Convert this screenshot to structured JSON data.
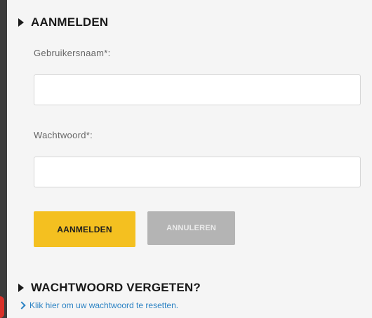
{
  "login": {
    "heading": "AANMELDEN",
    "username_label": "Gebruikersnaam*:",
    "username_value": "",
    "password_label": "Wachtwoord*:",
    "password_value": "",
    "submit_label": "AANMELDEN",
    "cancel_label": "ANNULEREN"
  },
  "forgot": {
    "heading": "WACHTWOORD VERGETEN?",
    "reset_link": "Klik hier om uw wachtwoord te resetten."
  },
  "icons": {
    "heading_marker": "triangle-right-icon",
    "link_marker": "chevron-right-icon"
  },
  "colors": {
    "submit_button": "#f4c020",
    "cancel_button": "#b4b4b4",
    "link": "#2c83c4",
    "background": "#f5f5f5"
  }
}
